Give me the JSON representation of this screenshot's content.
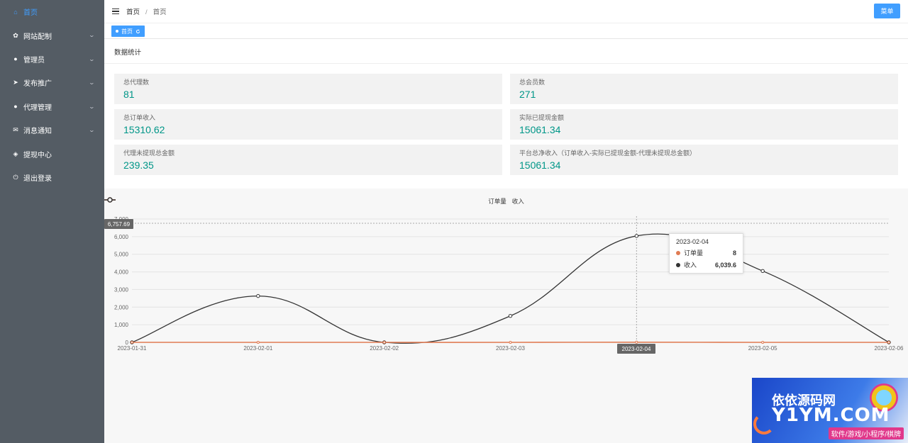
{
  "sidebar": {
    "items": [
      {
        "label": "首页",
        "icon": "home-icon",
        "active": true
      },
      {
        "label": "网站配制",
        "icon": "gear-icon",
        "expandable": true
      },
      {
        "label": "管理员",
        "icon": "user-icon",
        "expandable": true
      },
      {
        "label": "发布推广",
        "icon": "send-icon",
        "expandable": true
      },
      {
        "label": "代理管理",
        "icon": "user-icon",
        "expandable": true
      },
      {
        "label": "消息通知",
        "icon": "mail-icon",
        "expandable": true
      },
      {
        "label": "提现中心",
        "icon": "cube-icon"
      },
      {
        "label": "退出登录",
        "icon": "power-icon"
      }
    ]
  },
  "header": {
    "breadcrumb": [
      "首页",
      "首页"
    ],
    "breadcrumb_sep": "/",
    "menu_label": "菜单"
  },
  "tabs": [
    {
      "label": "首页"
    }
  ],
  "card": {
    "title": "数据统计"
  },
  "stats": [
    {
      "label": "总代理数",
      "value": "81"
    },
    {
      "label": "总会员数",
      "value": "271"
    },
    {
      "label": "总订单收入",
      "value": "15310.62"
    },
    {
      "label": "实际已提现金额",
      "value": "15061.34"
    },
    {
      "label": "代理未提现总金额",
      "value": "239.35"
    },
    {
      "label": "平台总净收入（订单收入-实际已提现金额-代理未提现总金额）",
      "value": "15061.34"
    }
  ],
  "colors": {
    "sidebar_bg": "#545c64",
    "accent": "#409eff",
    "stat_value": "#009688",
    "series_orders": "#e07b53",
    "series_income": "#333333"
  },
  "chart_data": {
    "type": "line",
    "categories": [
      "2023-01-31",
      "2023-02-01",
      "2023-02-02",
      "2023-02-03",
      "2023-02-04",
      "2023-02-05",
      "2023-02-06"
    ],
    "series": [
      {
        "name": "订单量",
        "values": [
          0,
          0,
          0,
          0,
          8,
          0,
          0
        ]
      },
      {
        "name": "收入",
        "values": [
          0,
          2630,
          0,
          1500,
          6039.6,
          4050,
          0
        ]
      }
    ],
    "y_ticks": [
      "0",
      "1,000",
      "2,000",
      "3,000",
      "4,000",
      "5,000",
      "6,000",
      "7,000"
    ],
    "ylim": [
      0,
      7000
    ],
    "grid": true,
    "legend": "top-center",
    "smooth": true,
    "crosshair": {
      "y_label": "6,757.69",
      "y_value": 6757.69,
      "x_label": "2023-02-04"
    },
    "tooltip": {
      "title": "2023-02-04",
      "rows": [
        {
          "name": "订单量",
          "value": "8"
        },
        {
          "name": "收入",
          "value": "6,039.6"
        }
      ]
    }
  },
  "watermark": {
    "line1": "依依源码网",
    "line2": "Y1YM.COM",
    "line3": "软件/游戏/小程序/棋牌"
  }
}
